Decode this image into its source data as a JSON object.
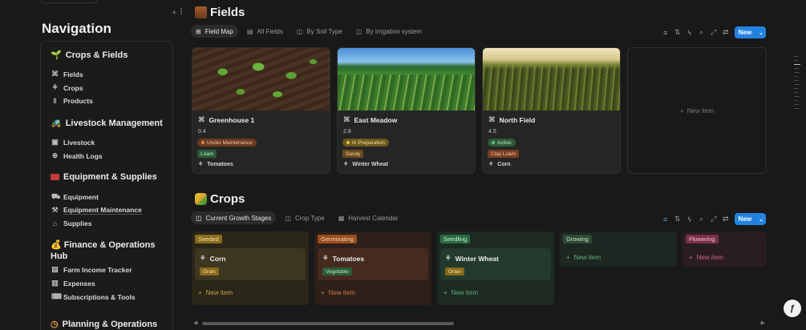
{
  "sidebar": {
    "title": "Navigation",
    "sections": [
      {
        "label": "Crops & Fields",
        "items": [
          "Fields",
          "Crops",
          "Products"
        ]
      },
      {
        "label": "Livestock Management",
        "items": [
          "Livestock",
          "Health Logs"
        ]
      },
      {
        "label": "Equipment & Supplies",
        "items": [
          "Equipment",
          "Equipment Maintenance",
          "Supplies"
        ]
      },
      {
        "label": "Finance & Operations Hub",
        "items": [
          "Farm Income Tracker",
          "Expenses",
          "Subscriptions & Tools"
        ]
      },
      {
        "label": "Planning & Operations",
        "items": []
      }
    ]
  },
  "fields_db": {
    "title": "Fields",
    "tabs": [
      "Field Map",
      "All Fields",
      "By Soil Type",
      "By irrigation system"
    ],
    "new_label": "New",
    "new_item_label": "New item",
    "cards": [
      {
        "name": "Greenhouse 1",
        "value": "0.4",
        "status": "Under Maintenance",
        "soil": "Loam",
        "crop": "Tomatoes"
      },
      {
        "name": "East Meadow",
        "value": "2.8",
        "status": "In Preparation",
        "soil": "Sandy",
        "crop": "Winter Wheat"
      },
      {
        "name": "North Field",
        "value": "4.5",
        "status": "Active",
        "soil": "Clay Loam",
        "crop": "Corn"
      }
    ]
  },
  "crops_db": {
    "title": "Crops",
    "tabs": [
      "Current Growth Stages",
      "Crop Type",
      "Harvest Calendar"
    ],
    "new_label": "New",
    "new_item_label": "New item",
    "columns": [
      {
        "stage": "Seeded",
        "card": "Corn",
        "type": "Grain"
      },
      {
        "stage": "Germinating",
        "card": "Tomatoes",
        "type": "Vegetable"
      },
      {
        "stage": "Seedling",
        "card": "Winter Wheat",
        "type": "Grain"
      },
      {
        "stage": "Growing",
        "card": null,
        "type": null
      },
      {
        "stage": "Flowering",
        "card": null,
        "type": null
      }
    ]
  },
  "colors": {
    "accent": "#2383e2",
    "seeded": "#8a6a1c",
    "germinating": "#9c4d1f",
    "seedling": "#2c6b43",
    "growing": "#2f4a36",
    "flowering": "#7a3048"
  },
  "icons": [
    "drag-handle-icon",
    "sprout-icon",
    "crop-icon",
    "grid-icon",
    "table-icon",
    "filter-icon",
    "sort-icon",
    "lightning-icon",
    "search-icon",
    "expand-icon",
    "settings-icon",
    "help-icon"
  ]
}
